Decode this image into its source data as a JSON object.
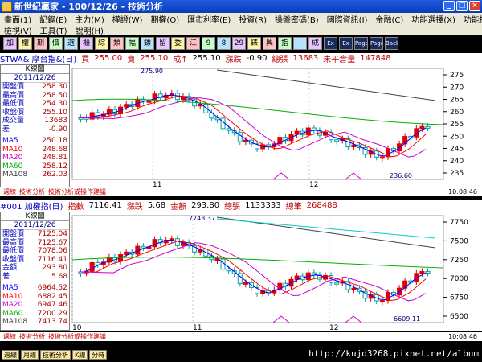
{
  "window": {
    "title": "新世紀贏家 - 100/12/26 - 技術分析"
  },
  "menu1": [
    "畫面(1)",
    "記錄(E)",
    "主力(M)",
    "權證(W)",
    "期權(O)",
    "匯市利率(E)",
    "投資(R)",
    "操盤密碼(B)",
    "國際資訊(I)",
    "金融(C)",
    "功能選擇(X)",
    "功能操作(F)"
  ],
  "menu2": [
    "檢視(V)",
    "工具(T)",
    "說明(H)"
  ],
  "toolbar": [
    "加",
    "權",
    "期",
    "價",
    "選",
    "櫃",
    "綜",
    "類",
    "幅",
    "鏢",
    "留",
    "委",
    "江",
    "9",
    "8",
    "29",
    "錶",
    "興",
    "指",
    "",
    "成",
    "Ex",
    "Ex",
    "Page",
    "Page",
    "Back"
  ],
  "panel1": {
    "header": [
      {
        "text": "STWA& 摩台指&(日)",
        "color": "#0000c0"
      },
      {
        "text": "買",
        "color": "#c00000"
      },
      {
        "text": "255.00",
        "color": "#c00000"
      },
      {
        "text": "賣",
        "color": "#c00000"
      },
      {
        "text": "255.10",
        "color": "#c00000"
      },
      {
        "text": "成↑",
        "color": "#c00000"
      },
      {
        "text": "255.10",
        "color": "#000000"
      },
      {
        "text": "漲跌",
        "color": "#c00000"
      },
      {
        "text": "-0.90",
        "color": "#000000"
      },
      {
        "text": "總張",
        "color": "#c00000"
      },
      {
        "text": "13683",
        "color": "#c00000"
      },
      {
        "text": "未平倉量",
        "color": "#c00000"
      },
      {
        "text": "147848",
        "color": "#c00000"
      }
    ],
    "box_title": "K線圖",
    "box_date": "2011/12/26",
    "rows": [
      [
        "開盤價",
        "258.30"
      ],
      [
        "最高價",
        "258.50"
      ],
      [
        "最低價",
        "254.30"
      ],
      [
        "收盤價",
        "255.10"
      ],
      [
        "成交量",
        "13683"
      ],
      [
        "差",
        "-0.90"
      ]
    ],
    "ma_rows": [
      [
        "MA5",
        "250.18"
      ],
      [
        "MA10",
        "248.68"
      ],
      [
        "MA20",
        "248.81"
      ],
      [
        "MA60",
        "258.12"
      ],
      [
        "MA108",
        "262.03"
      ]
    ],
    "yticks": [
      "275",
      "270",
      "265",
      "260",
      "255",
      "250",
      "245",
      "240",
      "235"
    ],
    "xticks": [
      "11",
      "12"
    ],
    "high_label": "275.90",
    "low_label": "236.60",
    "footer": [
      "週線",
      "技術分析",
      "技術分析或操作建議"
    ],
    "time": "10:08:46"
  },
  "panel2": {
    "header": [
      {
        "text": "#001 加權指(日)",
        "color": "#0000c0"
      },
      {
        "text": "指數",
        "color": "#c00000"
      },
      {
        "text": "7116.41",
        "color": "#000000"
      },
      {
        "text": "漲跌",
        "color": "#c00000"
      },
      {
        "text": "5.68",
        "color": "#000000"
      },
      {
        "text": "金額",
        "color": "#c00000"
      },
      {
        "text": "293.80",
        "color": "#000000"
      },
      {
        "text": "總張",
        "color": "#c00000"
      },
      {
        "text": "1133333",
        "color": "#000000"
      },
      {
        "text": "總筆",
        "color": "#c00000"
      },
      {
        "text": "268488",
        "color": "#c00000"
      }
    ],
    "box_title": "K線圖",
    "box_date": "2011/12/26",
    "rows": [
      [
        "開盤價",
        "7125.04"
      ],
      [
        "最高價",
        "7125.67"
      ],
      [
        "最低價",
        "7078.06"
      ],
      [
        "收盤價",
        "7116.41"
      ],
      [
        "金額",
        "293.80"
      ],
      [
        "差",
        "5.68"
      ]
    ],
    "ma_rows": [
      [
        "MA5",
        "6964.52"
      ],
      [
        "MA10",
        "6882.45"
      ],
      [
        "MA20",
        "6947.46"
      ],
      [
        "MA60",
        "7200.29"
      ],
      [
        "MA108",
        "7413.74"
      ]
    ],
    "yticks": [
      "7750",
      "7500",
      "7250",
      "7000",
      "6750",
      "6500"
    ],
    "xticks": [
      "10",
      "11",
      "12"
    ],
    "high_label": "7743.37",
    "low_label": "6609.11",
    "footer": [
      "週線",
      "技術分析",
      "技術分析或操作建議"
    ],
    "time": "10:08:46"
  },
  "status": {
    "buttons": [
      "週線",
      "月線",
      "技術分析",
      "K線",
      "分時"
    ],
    "url": "http://kujd3268.pixnet.net/album"
  },
  "colors": {
    "up": "#e00000",
    "down": "#0000ff",
    "ma5": "#0000ff",
    "ma10": "#ff0000",
    "ma20": "#cc00cc",
    "ma60": "#00b000",
    "ma108": "#404040",
    "cyan": "#00cccc"
  }
}
